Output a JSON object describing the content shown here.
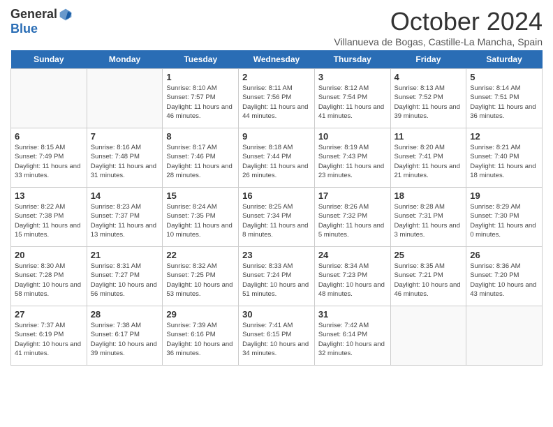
{
  "header": {
    "logo_general": "General",
    "logo_blue": "Blue",
    "title": "October 2024",
    "subtitle": "Villanueva de Bogas, Castille-La Mancha, Spain"
  },
  "days_of_week": [
    "Sunday",
    "Monday",
    "Tuesday",
    "Wednesday",
    "Thursday",
    "Friday",
    "Saturday"
  ],
  "weeks": [
    [
      {
        "day": "",
        "info": ""
      },
      {
        "day": "",
        "info": ""
      },
      {
        "day": "1",
        "info": "Sunrise: 8:10 AM\nSunset: 7:57 PM\nDaylight: 11 hours and 46 minutes."
      },
      {
        "day": "2",
        "info": "Sunrise: 8:11 AM\nSunset: 7:56 PM\nDaylight: 11 hours and 44 minutes."
      },
      {
        "day": "3",
        "info": "Sunrise: 8:12 AM\nSunset: 7:54 PM\nDaylight: 11 hours and 41 minutes."
      },
      {
        "day": "4",
        "info": "Sunrise: 8:13 AM\nSunset: 7:52 PM\nDaylight: 11 hours and 39 minutes."
      },
      {
        "day": "5",
        "info": "Sunrise: 8:14 AM\nSunset: 7:51 PM\nDaylight: 11 hours and 36 minutes."
      }
    ],
    [
      {
        "day": "6",
        "info": "Sunrise: 8:15 AM\nSunset: 7:49 PM\nDaylight: 11 hours and 33 minutes."
      },
      {
        "day": "7",
        "info": "Sunrise: 8:16 AM\nSunset: 7:48 PM\nDaylight: 11 hours and 31 minutes."
      },
      {
        "day": "8",
        "info": "Sunrise: 8:17 AM\nSunset: 7:46 PM\nDaylight: 11 hours and 28 minutes."
      },
      {
        "day": "9",
        "info": "Sunrise: 8:18 AM\nSunset: 7:44 PM\nDaylight: 11 hours and 26 minutes."
      },
      {
        "day": "10",
        "info": "Sunrise: 8:19 AM\nSunset: 7:43 PM\nDaylight: 11 hours and 23 minutes."
      },
      {
        "day": "11",
        "info": "Sunrise: 8:20 AM\nSunset: 7:41 PM\nDaylight: 11 hours and 21 minutes."
      },
      {
        "day": "12",
        "info": "Sunrise: 8:21 AM\nSunset: 7:40 PM\nDaylight: 11 hours and 18 minutes."
      }
    ],
    [
      {
        "day": "13",
        "info": "Sunrise: 8:22 AM\nSunset: 7:38 PM\nDaylight: 11 hours and 15 minutes."
      },
      {
        "day": "14",
        "info": "Sunrise: 8:23 AM\nSunset: 7:37 PM\nDaylight: 11 hours and 13 minutes."
      },
      {
        "day": "15",
        "info": "Sunrise: 8:24 AM\nSunset: 7:35 PM\nDaylight: 11 hours and 10 minutes."
      },
      {
        "day": "16",
        "info": "Sunrise: 8:25 AM\nSunset: 7:34 PM\nDaylight: 11 hours and 8 minutes."
      },
      {
        "day": "17",
        "info": "Sunrise: 8:26 AM\nSunset: 7:32 PM\nDaylight: 11 hours and 5 minutes."
      },
      {
        "day": "18",
        "info": "Sunrise: 8:28 AM\nSunset: 7:31 PM\nDaylight: 11 hours and 3 minutes."
      },
      {
        "day": "19",
        "info": "Sunrise: 8:29 AM\nSunset: 7:30 PM\nDaylight: 11 hours and 0 minutes."
      }
    ],
    [
      {
        "day": "20",
        "info": "Sunrise: 8:30 AM\nSunset: 7:28 PM\nDaylight: 10 hours and 58 minutes."
      },
      {
        "day": "21",
        "info": "Sunrise: 8:31 AM\nSunset: 7:27 PM\nDaylight: 10 hours and 56 minutes."
      },
      {
        "day": "22",
        "info": "Sunrise: 8:32 AM\nSunset: 7:25 PM\nDaylight: 10 hours and 53 minutes."
      },
      {
        "day": "23",
        "info": "Sunrise: 8:33 AM\nSunset: 7:24 PM\nDaylight: 10 hours and 51 minutes."
      },
      {
        "day": "24",
        "info": "Sunrise: 8:34 AM\nSunset: 7:23 PM\nDaylight: 10 hours and 48 minutes."
      },
      {
        "day": "25",
        "info": "Sunrise: 8:35 AM\nSunset: 7:21 PM\nDaylight: 10 hours and 46 minutes."
      },
      {
        "day": "26",
        "info": "Sunrise: 8:36 AM\nSunset: 7:20 PM\nDaylight: 10 hours and 43 minutes."
      }
    ],
    [
      {
        "day": "27",
        "info": "Sunrise: 7:37 AM\nSunset: 6:19 PM\nDaylight: 10 hours and 41 minutes."
      },
      {
        "day": "28",
        "info": "Sunrise: 7:38 AM\nSunset: 6:17 PM\nDaylight: 10 hours and 39 minutes."
      },
      {
        "day": "29",
        "info": "Sunrise: 7:39 AM\nSunset: 6:16 PM\nDaylight: 10 hours and 36 minutes."
      },
      {
        "day": "30",
        "info": "Sunrise: 7:41 AM\nSunset: 6:15 PM\nDaylight: 10 hours and 34 minutes."
      },
      {
        "day": "31",
        "info": "Sunrise: 7:42 AM\nSunset: 6:14 PM\nDaylight: 10 hours and 32 minutes."
      },
      {
        "day": "",
        "info": ""
      },
      {
        "day": "",
        "info": ""
      }
    ]
  ]
}
